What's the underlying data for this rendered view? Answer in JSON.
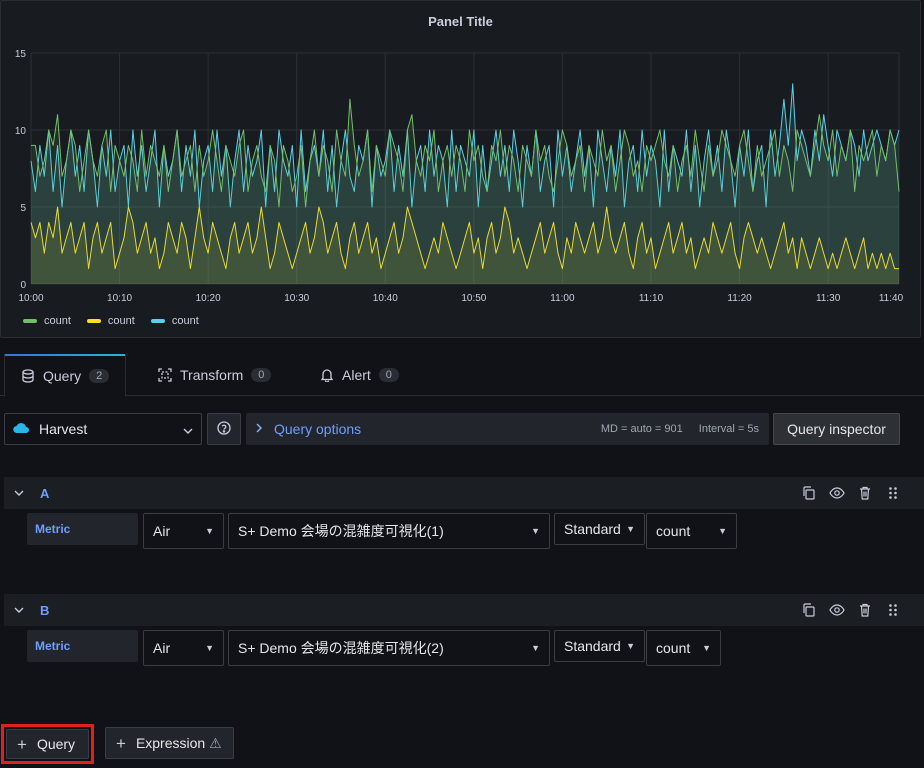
{
  "panel": {
    "title": "Panel Title"
  },
  "chart_data": {
    "type": "area",
    "title": "Panel Title",
    "xlabel": "",
    "ylabel": "",
    "ylim": [
      0,
      15
    ],
    "yticks": [
      "0",
      "5",
      "10",
      "15"
    ],
    "xticks": [
      "10:00",
      "10:10",
      "10:20",
      "10:30",
      "10:40",
      "10:50",
      "11:00",
      "11:10",
      "11:20",
      "11:30",
      "11:40"
    ],
    "x_start": "10:00",
    "x_step_minutes": 0.5,
    "grid": true,
    "legend_placement": "bottom-left",
    "series": [
      {
        "name": "count",
        "color": "#73bf69",
        "values": [
          9,
          9,
          7,
          8,
          10,
          9,
          11,
          7,
          8,
          10,
          9,
          6,
          8,
          10,
          8,
          7,
          9,
          10,
          6,
          9,
          8,
          7,
          9,
          8,
          6,
          10,
          7,
          9,
          8,
          7,
          9,
          6,
          8,
          10,
          7,
          8,
          9,
          6,
          9,
          7,
          8,
          10,
          8,
          6,
          9,
          8,
          7,
          9,
          10,
          6,
          8,
          9,
          7,
          6,
          9,
          8,
          5,
          9,
          8,
          6,
          7,
          9,
          5,
          8,
          10,
          7,
          9,
          8,
          6,
          10,
          8,
          7,
          12,
          9,
          7,
          8,
          10,
          6,
          9,
          8,
          7,
          10,
          9,
          8,
          6,
          10,
          11,
          8,
          7,
          9,
          8,
          10,
          6,
          8,
          9,
          7,
          9,
          8,
          6,
          10,
          8,
          9,
          7,
          6,
          9,
          8,
          10,
          7,
          9,
          8,
          6,
          9,
          8,
          7,
          10,
          8,
          9,
          7,
          6,
          8,
          10,
          9,
          7,
          8,
          9,
          6,
          9,
          8,
          7,
          10,
          8,
          9,
          6,
          8,
          10,
          9,
          7,
          8,
          6,
          9,
          8,
          9,
          10,
          8,
          7,
          9,
          6,
          8,
          9,
          7,
          10,
          8,
          6,
          9,
          7,
          8,
          10,
          9,
          8,
          7,
          9,
          10,
          8,
          6,
          9,
          7,
          8,
          9,
          10,
          7,
          9,
          8,
          6,
          10,
          9,
          8,
          7,
          9,
          11,
          9,
          8,
          10,
          7,
          9,
          8,
          10,
          6,
          9,
          8,
          9,
          10,
          7,
          9,
          8,
          10,
          9,
          6
        ]
      },
      {
        "name": "count",
        "color": "#fade2a",
        "values": [
          4,
          3,
          4,
          2,
          4,
          3,
          5,
          2,
          3,
          4,
          2,
          3,
          4,
          1,
          3,
          4,
          2,
          3,
          4,
          1,
          2,
          3,
          5,
          4,
          2,
          3,
          4,
          2,
          3,
          1,
          2,
          4,
          3,
          2,
          4,
          3,
          1,
          3,
          5,
          3,
          2,
          4,
          3,
          2,
          1,
          3,
          4,
          2,
          3,
          4,
          2,
          3,
          5,
          3,
          1,
          2,
          4,
          3,
          2,
          1,
          2,
          3,
          4,
          2,
          3,
          5,
          4,
          2,
          3,
          4,
          2,
          1,
          3,
          4,
          2,
          3,
          4,
          2,
          3,
          1,
          2,
          3,
          4,
          2,
          3,
          5,
          4,
          3,
          2,
          1,
          2,
          3,
          2,
          4,
          3,
          2,
          1,
          2,
          3,
          4,
          2,
          3,
          1,
          3,
          4,
          2,
          3,
          5,
          4,
          2,
          3,
          2,
          1,
          2,
          3,
          4,
          2,
          3,
          4,
          2,
          1,
          3,
          2,
          4,
          3,
          2,
          3,
          4,
          2,
          3,
          5,
          3,
          2,
          3,
          4,
          2,
          1,
          3,
          4,
          2,
          3,
          1,
          2,
          3,
          4,
          2,
          3,
          4,
          2,
          3,
          1,
          2,
          3,
          2,
          4,
          3,
          2,
          3,
          4,
          2,
          1,
          3,
          4,
          3,
          2,
          3,
          2,
          1,
          2,
          3,
          4,
          2,
          3,
          1,
          3,
          2,
          1,
          2,
          3,
          2,
          1,
          2,
          1,
          2,
          3,
          2,
          1,
          2,
          3,
          1,
          2,
          1,
          2,
          1,
          2,
          1,
          1
        ]
      },
      {
        "name": "count",
        "color": "#5ad1e6",
        "values": [
          8,
          6,
          9,
          7,
          10,
          6,
          9,
          5,
          8,
          10,
          7,
          9,
          6,
          10,
          8,
          5,
          9,
          7,
          10,
          6,
          8,
          9,
          5,
          10,
          7,
          9,
          6,
          8,
          10,
          5,
          9,
          7,
          8,
          10,
          6,
          9,
          7,
          10,
          5,
          8,
          9,
          6,
          10,
          7,
          9,
          5,
          8,
          10,
          6,
          9,
          7,
          8,
          10,
          5,
          9,
          6,
          10,
          8,
          7,
          9,
          5,
          10,
          6,
          8,
          9,
          7,
          10,
          6,
          9,
          5,
          8,
          10,
          7,
          6,
          9,
          8,
          10,
          5,
          9,
          7,
          8,
          10,
          6,
          9,
          7,
          10,
          5,
          8,
          9,
          6,
          10,
          7,
          9,
          8,
          5,
          10,
          6,
          9,
          8,
          7,
          10,
          5,
          9,
          6,
          8,
          10,
          7,
          9,
          6,
          10,
          8,
          5,
          9,
          7,
          10,
          6,
          8,
          9,
          5,
          10,
          7,
          9,
          6,
          8,
          10,
          7,
          9,
          5,
          10,
          8,
          6,
          9,
          7,
          10,
          5,
          8,
          9,
          6,
          10,
          7,
          9,
          8,
          5,
          10,
          6,
          9,
          8,
          7,
          10,
          6,
          9,
          5,
          8,
          10,
          7,
          9,
          6,
          10,
          8,
          5,
          9,
          7,
          10,
          6,
          8,
          9,
          5,
          10,
          7,
          9,
          12,
          9,
          13,
          8,
          10,
          9,
          7,
          10,
          8,
          11,
          9,
          7,
          10,
          9,
          8,
          10,
          9,
          7,
          10,
          8,
          9,
          10,
          9,
          8,
          10,
          9,
          10
        ]
      }
    ]
  },
  "legend": [
    {
      "label": "count",
      "color": "#73bf69"
    },
    {
      "label": "count",
      "color": "#fade2a"
    },
    {
      "label": "count",
      "color": "#5ad1e6"
    }
  ],
  "tabs": [
    {
      "label": "Query",
      "count": "2"
    },
    {
      "label": "Transform",
      "count": "0"
    },
    {
      "label": "Alert",
      "count": "0"
    }
  ],
  "toolbar": {
    "datasource": "Harvest",
    "help": "?",
    "query_options": "Query options",
    "md": "MD = auto = 901",
    "interval": "Interval = 5s",
    "inspector": "Query inspector"
  },
  "queries": [
    {
      "letter": "A",
      "metric_label": "Metric",
      "type": "Air",
      "target": "S+ Demo 会場の混雑度可視化(1)",
      "level": "Standard",
      "agg": "count"
    },
    {
      "letter": "B",
      "metric_label": "Metric",
      "type": "Air",
      "target": "S+ Demo 会場の混雑度可視化(2)",
      "level": "Standard",
      "agg": "count"
    }
  ],
  "buttons": {
    "add_query": "Query",
    "add_expression": "Expression",
    "warning_glyph": "⚠"
  }
}
